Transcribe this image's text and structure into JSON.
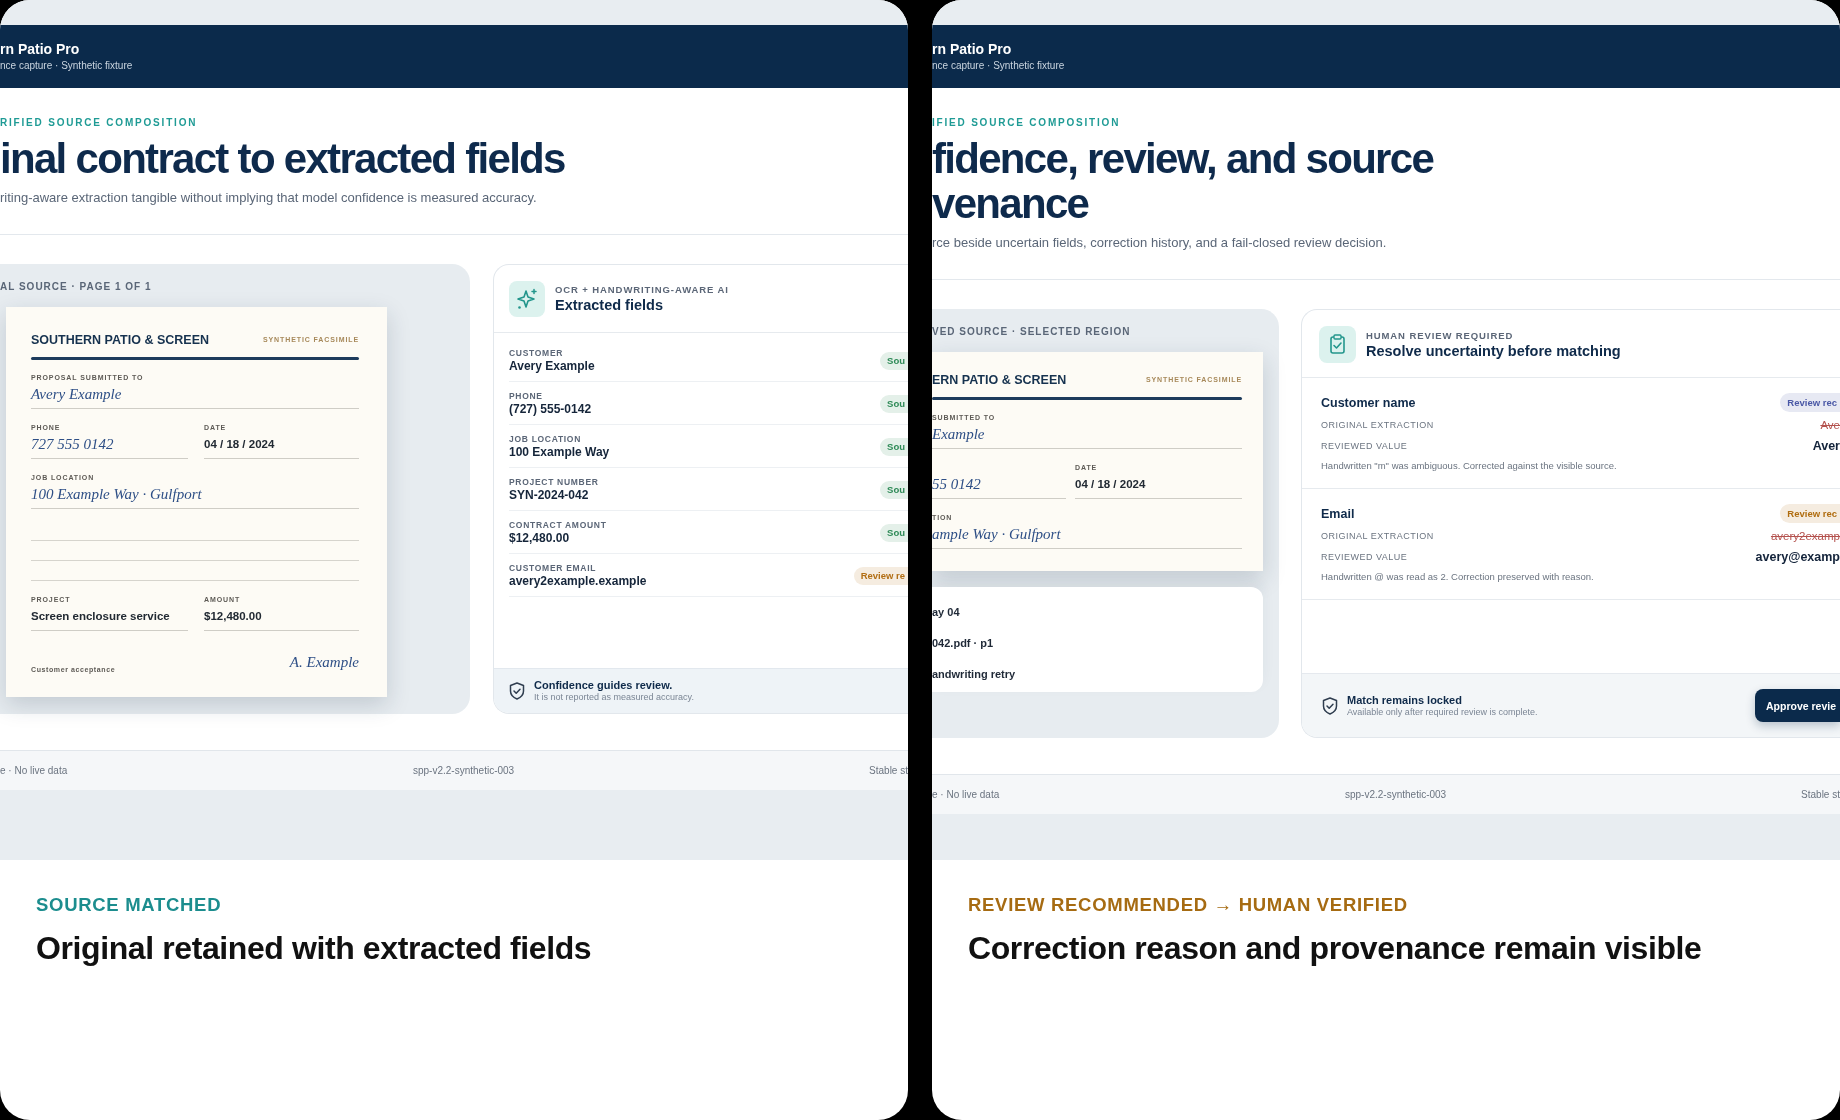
{
  "cards": [
    {
      "app": {
        "brand": "rn Patio Pro",
        "subtitle": "nce capture · Synthetic fixture",
        "eyebrow": "RIFIED SOURCE COMPOSITION",
        "title_lines": [
          "inal contract to extracted fields"
        ],
        "description": "riting-aware extraction tangible without implying that model confidence is measured accuracy."
      },
      "source": {
        "kind": "page",
        "label": "AL SOURCE · PAGE 1 OF 1",
        "document": {
          "company": "SOUTHERN PATIO & SCREEN",
          "stamp": "SYNTHETIC FACSIMILE",
          "rows": [
            {
              "kind": "fields",
              "fields": [
                {
                  "label": "PROPOSAL SUBMITTED TO",
                  "value": "Avery Example",
                  "kind": "handwritten"
                }
              ]
            },
            {
              "kind": "fields",
              "fields": [
                {
                  "label": "PHONE",
                  "value": "727 555 0142",
                  "kind": "handwritten"
                },
                {
                  "label": "DATE",
                  "value": "04 / 18 / 2024",
                  "kind": "typed"
                }
              ]
            },
            {
              "kind": "fields",
              "fields": [
                {
                  "label": "JOB LOCATION",
                  "value": "100 Example Way · Gulfport",
                  "kind": "handwritten"
                }
              ]
            },
            {
              "kind": "blank"
            },
            {
              "kind": "blank"
            },
            {
              "kind": "blank"
            },
            {
              "kind": "fields",
              "fields": [
                {
                  "label": "PROJECT",
                  "value": "Screen enclosure service",
                  "kind": "typed"
                },
                {
                  "label": "AMOUNT",
                  "value": "$12,480.00",
                  "kind": "typed"
                }
              ]
            },
            {
              "kind": "signature",
              "label": "Customer acceptance",
              "value": "A. Example"
            }
          ]
        }
      },
      "side": {
        "kind": "extracted",
        "eyebrow": "OCR + HANDWRITING-AWARE AI",
        "title": "Extracted fields",
        "rows": [
          {
            "label": "CUSTOMER",
            "value": "Avery Example",
            "badge": {
              "text": "Sou",
              "color": "#2e8a57"
            }
          },
          {
            "label": "PHONE",
            "value": "(727) 555-0142",
            "badge": {
              "text": "Sou",
              "color": "#2e8a57"
            }
          },
          {
            "label": "JOB LOCATION",
            "value": "100 Example Way",
            "badge": {
              "text": "Sou",
              "color": "#2e8a57"
            }
          },
          {
            "label": "PROJECT NUMBER",
            "value": "SYN-2024-042",
            "badge": {
              "text": "Sou",
              "color": "#2e8a57"
            }
          },
          {
            "label": "CONTRACT AMOUNT",
            "value": "$12,480.00",
            "badge": {
              "text": "Sou",
              "color": "#2e8a57"
            }
          },
          {
            "label": "CUSTOMER EMAIL",
            "value": "avery2example.example",
            "badge": {
              "text": "Review re",
              "color": "#b26e14"
            }
          }
        ],
        "note": {
          "title": "Confidence guides review.",
          "text": "It is not reported as measured accuracy."
        }
      },
      "footer": {
        "left": "e · No live data",
        "center": "spp-v2.2-synthetic-003",
        "right": "Stable st"
      },
      "caption": {
        "status": "SOURCE MATCHED",
        "color": "#1c8d8e",
        "heading": "Original retained with extracted fields"
      }
    },
    {
      "app": {
        "brand": "rn Patio Pro",
        "subtitle": "nce capture · Synthetic fixture",
        "eyebrow": "IFIED SOURCE COMPOSITION",
        "title_lines": [
          "fidence, review, and source",
          "venance"
        ],
        "description": "rce beside uncertain fields, correction history, and a fail-closed review decision."
      },
      "source": {
        "kind": "region",
        "label": "VED SOURCE · SELECTED REGION",
        "document": {
          "company": "ERN PATIO & SCREEN",
          "stamp": "SYNTHETIC FACSIMILE",
          "rows": [
            {
              "kind": "fields",
              "fields": [
                {
                  "label": "SUBMITTED TO",
                  "value": "Example",
                  "kind": "handwritten"
                }
              ]
            },
            {
              "kind": "fields",
              "fields": [
                {
                  "value": "55 0142",
                  "kind": "handwritten"
                },
                {
                  "label": "DATE",
                  "value": "04 / 18 / 2024",
                  "kind": "typed"
                }
              ]
            },
            {
              "kind": "fields",
              "fields": [
                {
                  "label": "TION",
                  "value": "ample Way · Gulfport",
                  "kind": "handwritten"
                }
              ]
            }
          ]
        },
        "provenance": [
          "ay 04",
          "042.pdf · p1",
          "andwriting retry"
        ]
      },
      "side": {
        "kind": "review",
        "eyebrow": "HUMAN REVIEW REQUIRED",
        "title": "Resolve uncertainty before matching",
        "items": [
          {
            "name": "Customer name",
            "badge": {
              "text": "Review rec",
              "color": "#4a58a6"
            },
            "original_label": "ORIGINAL EXTRACTION",
            "original_value": "Ave",
            "reviewed_label": "REVIEWED VALUE",
            "reviewed_value": "Aver",
            "note": "Handwritten \"m\" was ambiguous. Corrected against the visible source."
          },
          {
            "name": "Email",
            "badge": {
              "text": "Review rec",
              "color": "#b06d10"
            },
            "original_label": "ORIGINAL EXTRACTION",
            "original_value": "avery2examp",
            "reviewed_label": "REVIEWED VALUE",
            "reviewed_value": "avery@examp",
            "note": "Handwritten @ was read as 2. Correction preserved with reason."
          }
        ],
        "footer": {
          "title": "Match remains locked",
          "text": "Available only after required review is complete.",
          "button": "Approve revie"
        }
      },
      "footer": {
        "left": "e · No live data",
        "center": "spp-v2.2-synthetic-003",
        "right": "Stable st"
      },
      "caption": {
        "status": "REVIEW RECOMMENDED → HUMAN VERIFIED",
        "color": "#a66b12",
        "heading": "Correction reason and provenance remain visible"
      }
    }
  ]
}
